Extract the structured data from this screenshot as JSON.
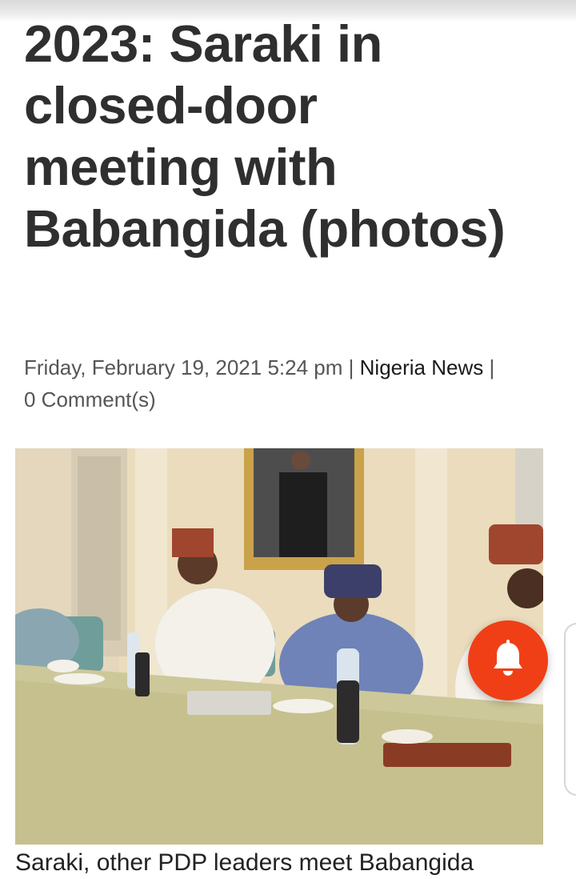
{
  "article": {
    "title": "2023: Saraki in closed-door meeting with Babangida (photos)",
    "date": "Friday, February 19, 2021 5:24 pm",
    "separator": "|",
    "category": "Nigeria News",
    "comments": "0 Comment(s)",
    "caption": "Saraki, other PDP leaders meet Babangida"
  },
  "colors": {
    "accent": "#f03f17",
    "title": "#2f2f2f",
    "meta": "#555555"
  },
  "icons": {
    "notification": "bell-icon"
  }
}
